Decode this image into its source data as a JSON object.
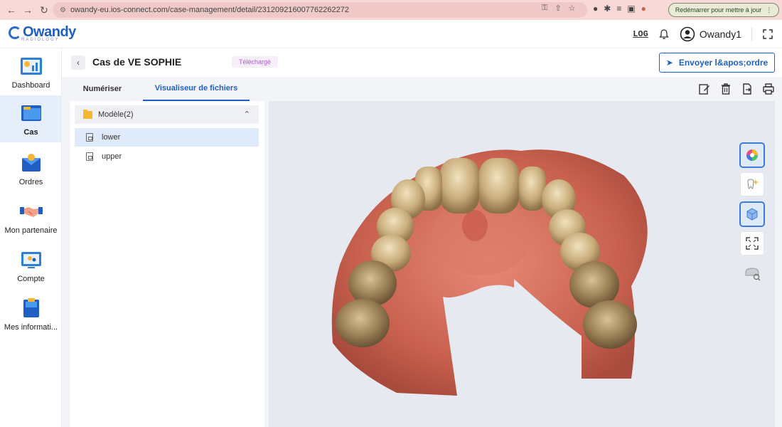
{
  "browser": {
    "url": "owandy-eu.ios-connect.com/case-management/detail/2312092160077622622​72",
    "restart_label": "Redémarrer pour mettre à jour"
  },
  "header": {
    "logo_text": "Owandy",
    "logo_sub": "RADIOLOGY",
    "log_label": "LOG",
    "username": "Owandy1"
  },
  "sidebar": {
    "items": [
      {
        "label": "Dashboard",
        "icon": "dashboard-icon"
      },
      {
        "label": "Cas",
        "icon": "folder-cases-icon"
      },
      {
        "label": "Ordres",
        "icon": "orders-icon"
      },
      {
        "label": "Mon partenaire",
        "icon": "handshake-icon"
      },
      {
        "label": "Compte",
        "icon": "account-icon"
      },
      {
        "label": "Mes informati...",
        "icon": "info-icon"
      }
    ]
  },
  "case": {
    "title": "Cas de VE  SOPHIE",
    "status": "Téléchargé",
    "send_label": "Envoyer l&apos;ordre"
  },
  "tabs": [
    {
      "label": "Numériser"
    },
    {
      "label": "Visualiseur de fichiers"
    }
  ],
  "files": {
    "folder_label": "Modèle(2)",
    "items": [
      {
        "name": "lower"
      },
      {
        "name": "upper"
      }
    ]
  },
  "colors": {
    "brand": "#1f5fc4",
    "badge_text": "#b35bd0",
    "folder": "#f5b731"
  }
}
